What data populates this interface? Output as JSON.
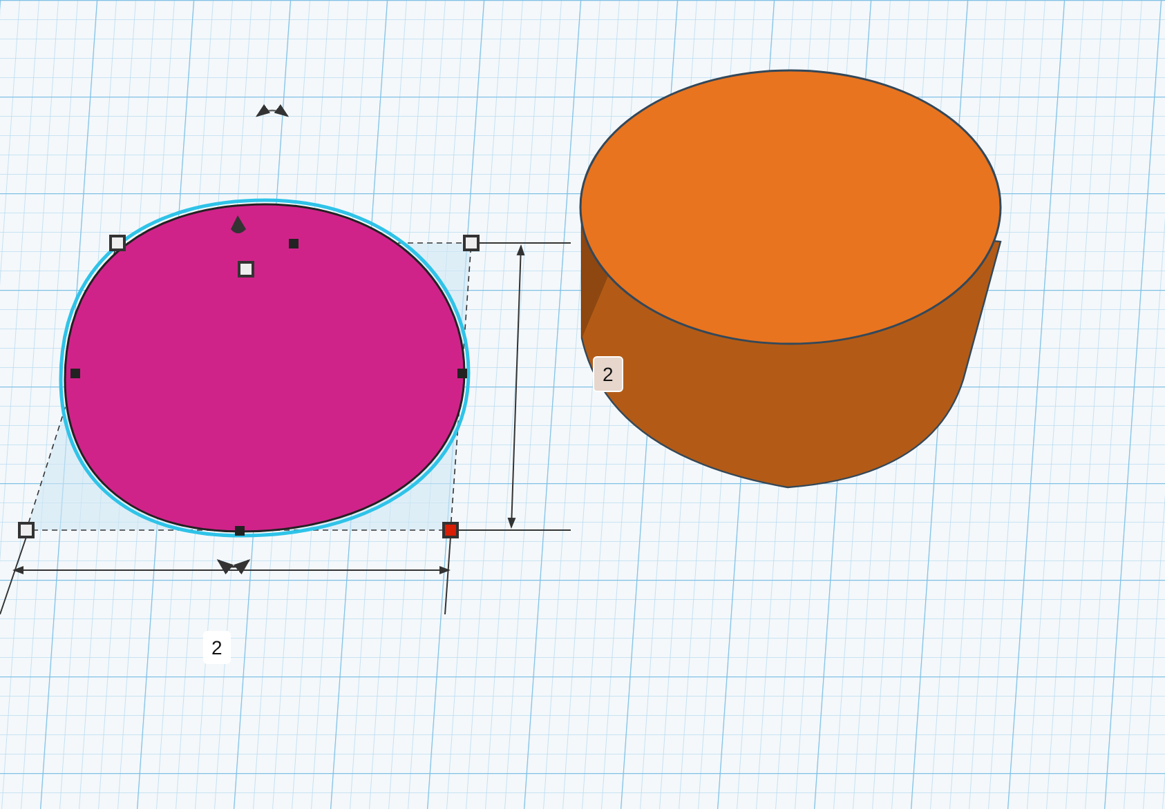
{
  "shapes": [
    {
      "kind": "half-sphere",
      "color": "#d0238a",
      "selected": true
    },
    {
      "kind": "cylinder",
      "color": "#e8741f",
      "selected": false
    }
  ],
  "height_label": "2",
  "width_label": "2"
}
